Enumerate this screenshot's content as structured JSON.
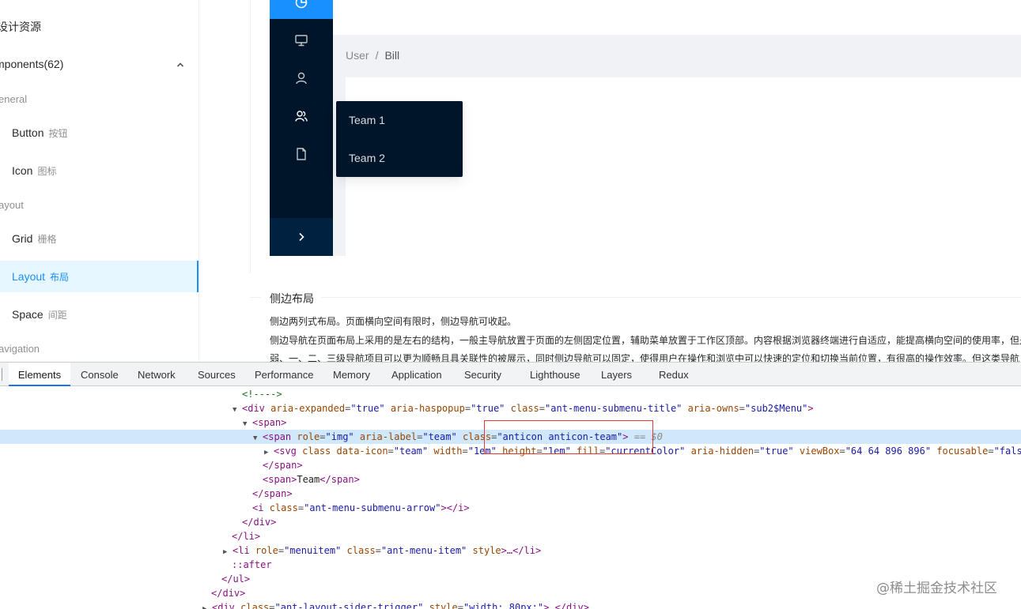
{
  "docs_sidebar": {
    "head": "设计资源",
    "group": "mponents(62)",
    "categories": [
      "General",
      "Layout",
      "Navigation"
    ],
    "category_display": [
      "eneral",
      "ayout",
      "avigation"
    ],
    "items": [
      {
        "label": "Button",
        "sub": "按钮"
      },
      {
        "label": "Icon",
        "sub": "图标"
      },
      {
        "label": "Grid",
        "sub": "栅格"
      },
      {
        "label": "Layout",
        "sub": "布局",
        "active": true
      },
      {
        "label": "Space",
        "sub": "间距"
      }
    ]
  },
  "demo": {
    "breadcrumb": [
      "User",
      "/",
      "Bill"
    ],
    "popup_items": [
      "Team 1",
      "Team 2"
    ],
    "sider_icons": [
      "pie-chart-icon",
      "desktop-icon",
      "user-icon",
      "team-icon",
      "file-icon"
    ],
    "trigger_icon": "chevron-right-icon"
  },
  "section": {
    "title": "侧边布局",
    "paragraph1": "侧边两列式布局。页面横向空间有限时，侧边导航可收起。",
    "paragraph2": "侧边导航在页面布局上采用的是左右的结构，一般主导航放置于页面的左侧固定位置，辅助菜单放置于工作区顶部。内容根据浏览器终端进行自适应，能提高横向空间的使用率，但是",
    "paragraph3": "弱、一、二、三级导航项目可以更为顺畅且具关联性的被展示，同时侧边导航可以固定，使得用户在操作和浏览中可以快速的定位和切换当前位置，有很高的操作效率。但这类导航"
  },
  "devtools": {
    "tabs": [
      "Elements",
      "Console",
      "Network",
      "Sources",
      "Performance",
      "Memory",
      "Application",
      "Security",
      "Lighthouse",
      "Layers",
      "Redux"
    ],
    "active_tab": "Elements",
    "lines": {
      "l0": "<!---->",
      "l1_tag": "div",
      "l1_attrs": [
        [
          "aria-expanded",
          "\"true\""
        ],
        [
          "aria-haspopup",
          "\"true\""
        ],
        [
          "class",
          "\"ant-menu-submenu-title\""
        ],
        [
          "aria-owns",
          "\"sub2$Menu\""
        ]
      ],
      "l2": "span",
      "l3_tag": "span",
      "l3_attrs": [
        [
          "role",
          "\"img\""
        ],
        [
          "aria-label",
          "\"team\""
        ],
        [
          "class",
          "\"anticon anticon-team\""
        ]
      ],
      "l3_suffix": "== $0",
      "l4_tag": "svg",
      "l4_attrs": [
        [
          "class",
          ""
        ],
        [
          "data-icon",
          "\"team\""
        ],
        [
          "width",
          "\"1em\""
        ],
        [
          "height",
          "\"1em\""
        ],
        [
          "fill",
          "\"currentColor\""
        ],
        [
          "aria-hidden",
          "\"true\""
        ],
        [
          "viewBox",
          "\"64 64 896 896\""
        ],
        [
          "focusable",
          "\"fals"
        ]
      ],
      "l5": "</span>",
      "l6_open": "<span>",
      "l6_text": "Team",
      "l6_close": "</span>",
      "l7": "</span>",
      "l8_tag": "i",
      "l8_attrs": [
        [
          "class",
          "\"ant-menu-submenu-arrow\""
        ]
      ],
      "l8_close": "</i>",
      "l9": "</div>",
      "l10": "</li>",
      "l11_tag": "li",
      "l11_attrs": [
        [
          "role",
          "\"menuitem\""
        ],
        [
          "class",
          "\"ant-menu-item\""
        ],
        [
          "style",
          ""
        ]
      ],
      "l11_tail": "…</li>",
      "l12": "::after",
      "l13": "</ul>",
      "l14": "</div>",
      "l15_tag": "div",
      "l15_attrs": [
        [
          "class",
          "\"ant-layout-sider-trigger\""
        ],
        [
          "style",
          "\"width: 80px;\""
        ]
      ],
      "l15_tail": "…</div>"
    }
  },
  "watermark": "@稀土掘金技术社区",
  "colors": {
    "sider_bg": "#001529",
    "primary": "#1890ff",
    "layout_bg": "#f0f2f5",
    "selection_bg": "#cfe8fc",
    "highlight": "#e53935"
  }
}
